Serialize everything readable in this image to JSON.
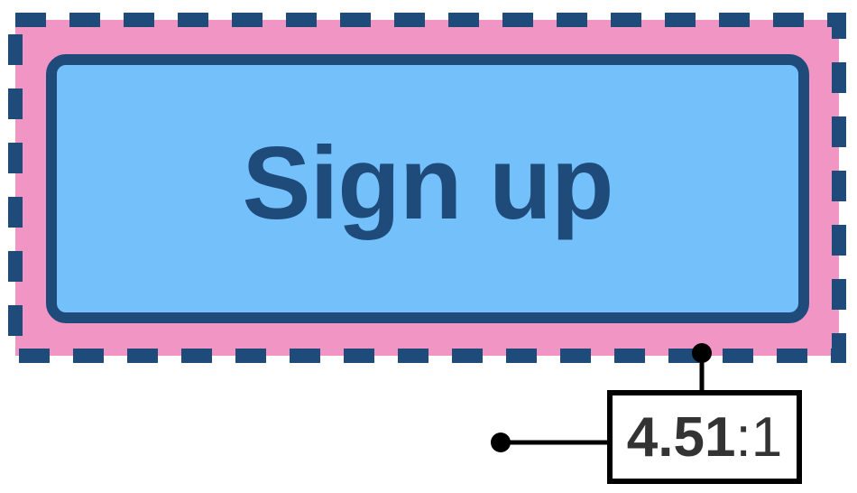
{
  "button": {
    "label": "Sign up"
  },
  "contrast": {
    "value": "4.51",
    "separator": ":",
    "base": "1"
  },
  "colors": {
    "padding_area": "#f195c5",
    "button_fill": "#74c0fb",
    "button_border_and_text": "#1f4b7a",
    "ratio_text": "#333333",
    "connector": "#000000"
  }
}
